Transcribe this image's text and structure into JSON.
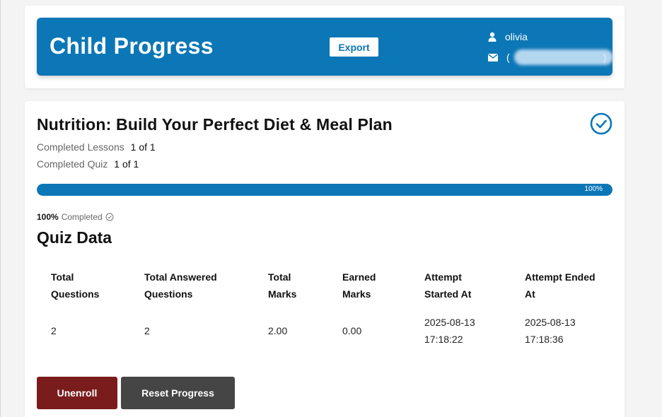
{
  "header": {
    "title": "Child Progress",
    "export_label": "Export",
    "username": "olivia",
    "email_open": "(",
    "email_close": ")"
  },
  "course": {
    "title": "Nutrition: Build Your Perfect Diet & Meal Plan",
    "lessons_label": "Completed Lessons",
    "lessons_value": "1 of 1",
    "quiz_label": "Completed Quiz",
    "quiz_value": "1 of 1",
    "progress_percent": 100,
    "progress_text": "100%",
    "completed_pct": "100%",
    "completed_label": "Completed"
  },
  "quiz": {
    "title": "Quiz Data",
    "headers": [
      [
        "Total",
        "Questions"
      ],
      [
        "Total Answered",
        "Questions"
      ],
      [
        "Total",
        "Marks"
      ],
      [
        "Earned",
        "Marks"
      ],
      [
        "Attempt",
        "Started At"
      ],
      [
        "Attempt Ended",
        "At"
      ]
    ],
    "row": {
      "total_questions": "2",
      "answered_questions": "2",
      "total_marks": "2.00",
      "earned_marks": "0.00",
      "started_date": "2025-08-13",
      "started_time": "17:18:22",
      "ended_date": "2025-08-13",
      "ended_time": "17:18:36"
    }
  },
  "actions": {
    "unenroll_label": "Unenroll",
    "reset_label": "Reset Progress"
  },
  "colors": {
    "brand_blue": "#0c77b6",
    "unenroll_red": "#7a1c1c",
    "reset_gray": "#454545"
  },
  "icons": {
    "user": "user-icon",
    "mail": "mail-icon",
    "completed_check": "check-circle-icon",
    "small_check": "check-circle-small-icon"
  }
}
